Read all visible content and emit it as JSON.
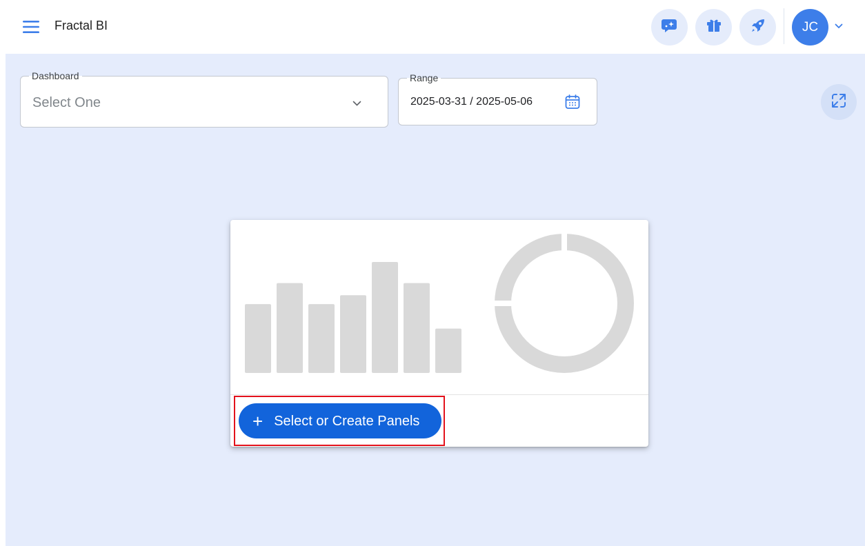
{
  "app": {
    "title": "Fractal BI"
  },
  "header": {
    "menu_icon": "hamburger-menu-icon",
    "actions": [
      {
        "name": "ai-chat-button",
        "icon": "chat-sparkle-icon"
      },
      {
        "name": "gifts-button",
        "icon": "gift-icon"
      },
      {
        "name": "launch-button",
        "icon": "rocket-icon"
      }
    ],
    "user": {
      "initials": "JC",
      "caret_icon": "chevron-down-icon"
    }
  },
  "filters": {
    "dashboard": {
      "label": "Dashboard",
      "value": "Select One",
      "caret_icon": "chevron-down-icon"
    },
    "range": {
      "label": "Range",
      "value": "2025-03-31 / 2025-05-06",
      "icon": "calendar-icon"
    }
  },
  "toolbar": {
    "expand_icon": "expand-icon"
  },
  "empty_state": {
    "placeholder_bars": [
      0.62,
      0.81,
      0.62,
      0.7,
      1.0,
      0.81,
      0.4
    ],
    "placeholder_donut": "donut-placeholder",
    "button_icon": "+",
    "button_label": "Select or Create Panels"
  },
  "colors": {
    "accent": "#1264db",
    "avatar": "#3d7ee9",
    "canvas": "#e5ecfc",
    "placeholder": "#d9d9d9",
    "highlight": "#e3111b"
  }
}
